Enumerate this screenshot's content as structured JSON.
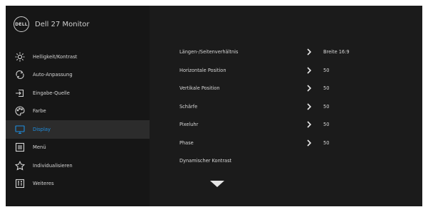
{
  "brand": {
    "logo_text": "DELL",
    "title": "Dell 27 Monitor"
  },
  "menu": [
    {
      "label": "Helligkeit/Kontrast",
      "icon": "brightness-icon"
    },
    {
      "label": "Auto-Anpassung",
      "icon": "auto-adjust-icon"
    },
    {
      "label": "Eingabe-Quelle",
      "icon": "input-source-icon"
    },
    {
      "label": "Farbe",
      "icon": "color-icon"
    },
    {
      "label": "Display",
      "icon": "display-icon",
      "active": true
    },
    {
      "label": "Menü",
      "icon": "menu-icon"
    },
    {
      "label": "Individualisieren",
      "icon": "star-icon"
    },
    {
      "label": "Weiteres",
      "icon": "others-icon"
    }
  ],
  "settings": [
    {
      "label": "Längen-/Seitenverhältnis",
      "value": "Breite 16:9"
    },
    {
      "label": "Horizontale Position",
      "value": "50"
    },
    {
      "label": "Vertikale Position",
      "value": "50"
    },
    {
      "label": "Schärfe",
      "value": "50"
    },
    {
      "label": "Pixeluhr",
      "value": "50"
    },
    {
      "label": "Phase",
      "value": "50"
    },
    {
      "label": "Dynamischer Kontrast",
      "value": ""
    }
  ],
  "colors": {
    "accent": "#1e8ee0",
    "background": "#1b1b1b",
    "sidebar": "#161616",
    "active_row": "#2c2c2c"
  }
}
